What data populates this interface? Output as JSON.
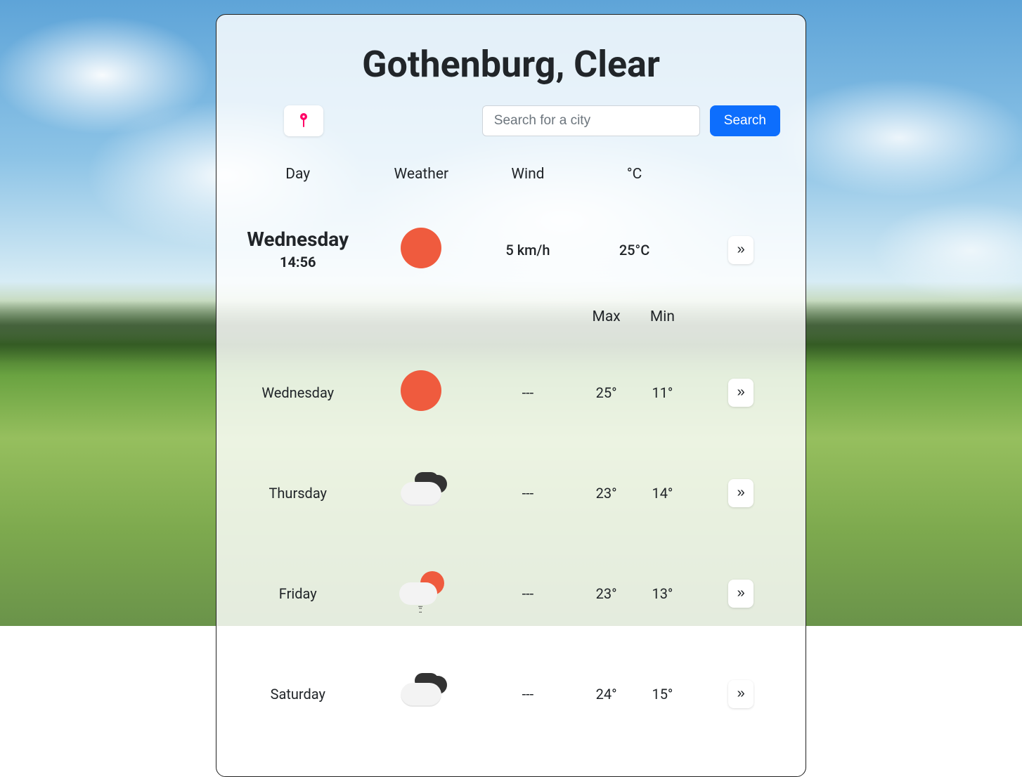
{
  "title": "Gothenburg, Clear",
  "search": {
    "placeholder": "Search for a city",
    "button": "Search"
  },
  "columns": {
    "day": "Day",
    "weather": "Weather",
    "wind": "Wind",
    "temp": "°C",
    "max": "Max",
    "min": "Min"
  },
  "more_glyph": "»",
  "today": {
    "day": "Wednesday",
    "time": "14:56",
    "wind": "5 km/h",
    "temp": "25°C",
    "icon": "sun"
  },
  "forecast": [
    {
      "day": "Wednesday",
      "icon": "sun",
      "wind": "---",
      "max": "25°",
      "min": "11°"
    },
    {
      "day": "Thursday",
      "icon": "clouds",
      "wind": "---",
      "max": "23°",
      "min": "14°"
    },
    {
      "day": "Friday",
      "icon": "sun-rain",
      "wind": "---",
      "max": "23°",
      "min": "13°"
    },
    {
      "day": "Saturday",
      "icon": "clouds",
      "wind": "---",
      "max": "24°",
      "min": "15°"
    }
  ]
}
